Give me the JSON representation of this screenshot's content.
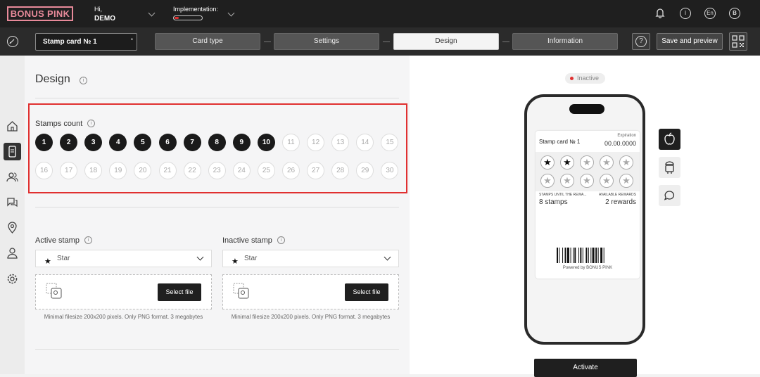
{
  "header": {
    "logo": "BONUS PINK",
    "greeting": "Hi,",
    "user": "DEMO",
    "implementation_label": "Implementation:",
    "implementation_progress": 0.15,
    "language": "En",
    "avatar": "B",
    "info_glyph": "i"
  },
  "toolbar": {
    "card_name": "Stamp card № 1",
    "required_mark": "*",
    "steps": [
      {
        "label": "Card type",
        "active": false
      },
      {
        "label": "Settings",
        "active": false
      },
      {
        "label": "Design",
        "active": true
      },
      {
        "label": "Information",
        "active": false
      }
    ],
    "help": "?",
    "save": "Save and preview"
  },
  "sidebar": {
    "items": [
      "home-icon",
      "card-icon",
      "users-icon",
      "chat-icon",
      "location-icon",
      "contacts-icon",
      "settings-icon"
    ],
    "active": 1
  },
  "design": {
    "title": "Design",
    "info": "i",
    "stamps_count_label": "Stamps count",
    "stamps": [
      "1",
      "2",
      "3",
      "4",
      "5",
      "6",
      "7",
      "8",
      "9",
      "10",
      "11",
      "12",
      "13",
      "14",
      "15",
      "16",
      "17",
      "18",
      "19",
      "20",
      "21",
      "22",
      "23",
      "24",
      "25",
      "26",
      "27",
      "28",
      "29",
      "30"
    ],
    "selected_count": 10,
    "active_stamp": {
      "label": "Active stamp",
      "value": "Star",
      "button": "Select file",
      "hint": "Minimal filesize 200x200 pixels. Only PNG format. 3 megabytes"
    },
    "inactive_stamp": {
      "label": "Inactive stamp",
      "value": "Star",
      "button": "Select file",
      "hint": "Minimal filesize 200x200 pixels. Only PNG format. 3 megabytes"
    }
  },
  "preview": {
    "status": "Inactive",
    "status_color": "#e03030",
    "card": {
      "name": "Stamp card № 1",
      "expiration_label": "Expiration",
      "expiration_value": "00.00.0000",
      "stamps_total": 10,
      "stamps_filled": 2,
      "until_reward_label": "STAMPS UNTIL THE REWA...",
      "until_reward_value": "8 stamps",
      "rewards_label": "AVAILABLE REWARDS",
      "rewards_value": "2 rewards",
      "powered": "Powered by BONUS PINK"
    },
    "platforms": [
      "apple-icon",
      "android-icon",
      "message-icon"
    ],
    "activate": "Activate"
  }
}
